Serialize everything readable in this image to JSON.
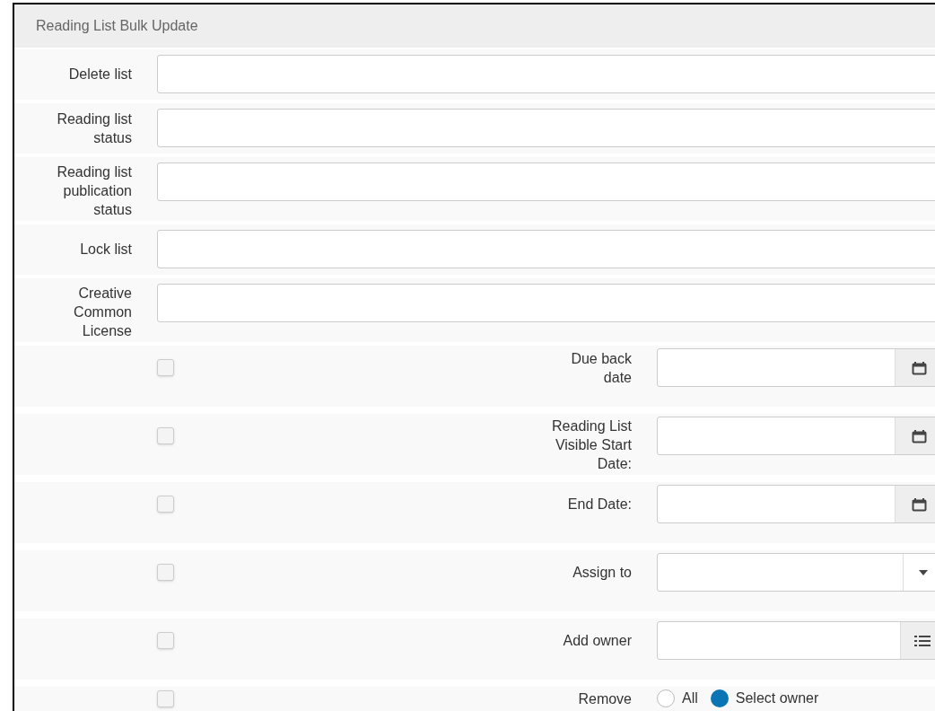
{
  "panel": {
    "title": "Reading List Bulk Update"
  },
  "fields": [
    {
      "label": "Delete list"
    },
    {
      "label": "Reading list status"
    },
    {
      "label": "Reading list publication status"
    },
    {
      "label": "Lock list"
    },
    {
      "label": "Creative Common License"
    }
  ],
  "options": [
    {
      "label": "Due back date",
      "checked": false,
      "kind": "date"
    },
    {
      "label": "Reading List Visible Start Date:",
      "checked": false,
      "kind": "date"
    },
    {
      "label": "End Date:",
      "checked": false,
      "kind": "date"
    },
    {
      "label": "Assign to",
      "checked": false,
      "kind": "select"
    },
    {
      "label": "Add owner",
      "checked": false,
      "kind": "picker"
    },
    {
      "label": "Remove",
      "checked": false,
      "kind": "radio",
      "choices": [
        {
          "label": "All",
          "selected": false
        },
        {
          "label": "Select owner",
          "selected": true
        }
      ]
    }
  ]
}
